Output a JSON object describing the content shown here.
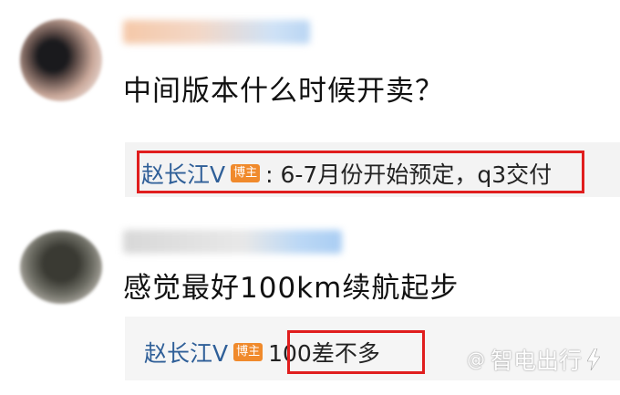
{
  "comments": [
    {
      "text": "中间版本什么时候开卖？",
      "reply": {
        "author": "赵长江V",
        "badge": "博主",
        "text": ": 6-7月份开始预定，q3交付"
      }
    },
    {
      "text": "感觉最好100km续航起步",
      "reply": {
        "author": "赵长江V",
        "badge": "博主",
        "text": "100差不多"
      }
    }
  ],
  "watermark": {
    "at": "@",
    "brand": "智电出行"
  },
  "colors": {
    "highlight_border": "#e01e1e",
    "author": "#2f5f98",
    "badge_bg": "#f08a2c"
  }
}
